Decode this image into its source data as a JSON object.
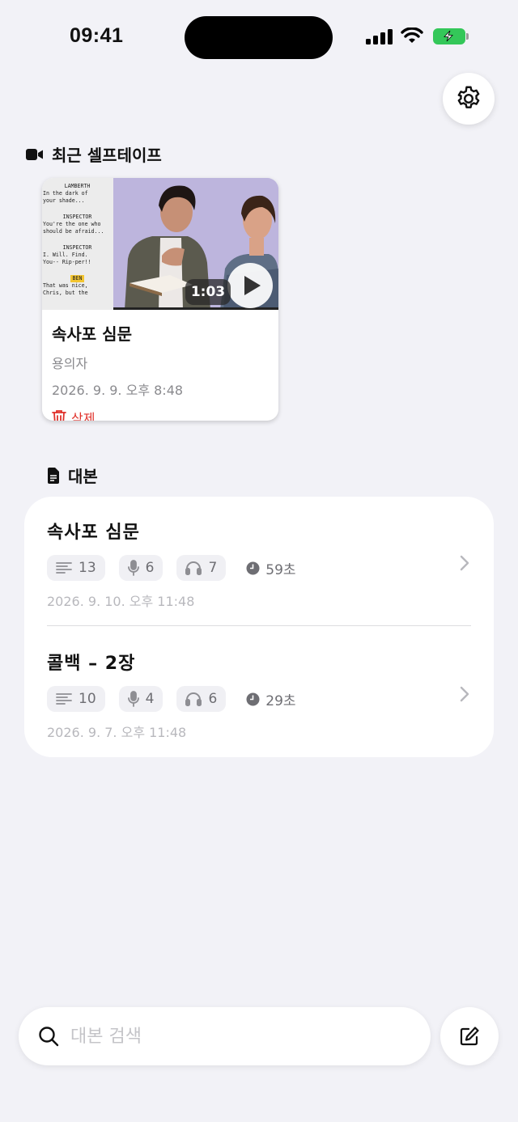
{
  "status_bar": {
    "time": "09:41"
  },
  "recent_tapes": {
    "header": "최근 셀프테이프",
    "items": [
      {
        "title": "속사포 심문",
        "role": "용의자",
        "date": "2026. 9. 9. 오후 8:48",
        "duration": "1:03",
        "delete_label": "삭제",
        "script_preview": [
          {
            "text": "LAMBERTH",
            "kind": "character"
          },
          {
            "text": "In the dark of",
            "kind": "line"
          },
          {
            "text": "your shade...",
            "kind": "line"
          },
          {
            "text": "INSPECTOR",
            "kind": "character"
          },
          {
            "text": "You're the one who",
            "kind": "line"
          },
          {
            "text": "should be afraid...",
            "kind": "line"
          },
          {
            "text": "INSPECTOR",
            "kind": "character"
          },
          {
            "text": "I. Will. Find.",
            "kind": "line"
          },
          {
            "text": "You-- Rip-per!!",
            "kind": "line"
          },
          {
            "text": "BEN",
            "kind": "highlight"
          },
          {
            "text": "That was nice,",
            "kind": "line"
          },
          {
            "text": "Chris, but the",
            "kind": "line"
          }
        ]
      }
    ]
  },
  "scripts": {
    "header": "대본",
    "items": [
      {
        "title": "속사포  심문",
        "lines": "13",
        "mic": "6",
        "listen": "7",
        "duration": "59초",
        "date": "2026. 9. 10. 오후 11:48"
      },
      {
        "title": "콜백  –  2장",
        "lines": "10",
        "mic": "4",
        "listen": "6",
        "duration": "29초",
        "date": "2026. 9. 7. 오후 11:48"
      }
    ]
  },
  "search": {
    "placeholder": "대본 검색"
  },
  "colors": {
    "background": "#f2f2f7",
    "delete": "#e0302a",
    "battery": "#34c759"
  },
  "icons": [
    "gear-icon",
    "video-camera-icon",
    "trash-icon",
    "document-icon",
    "lines-icon",
    "microphone-icon",
    "headphones-icon",
    "clock-icon",
    "chevron-right-icon",
    "search-icon",
    "compose-icon",
    "play-icon"
  ]
}
